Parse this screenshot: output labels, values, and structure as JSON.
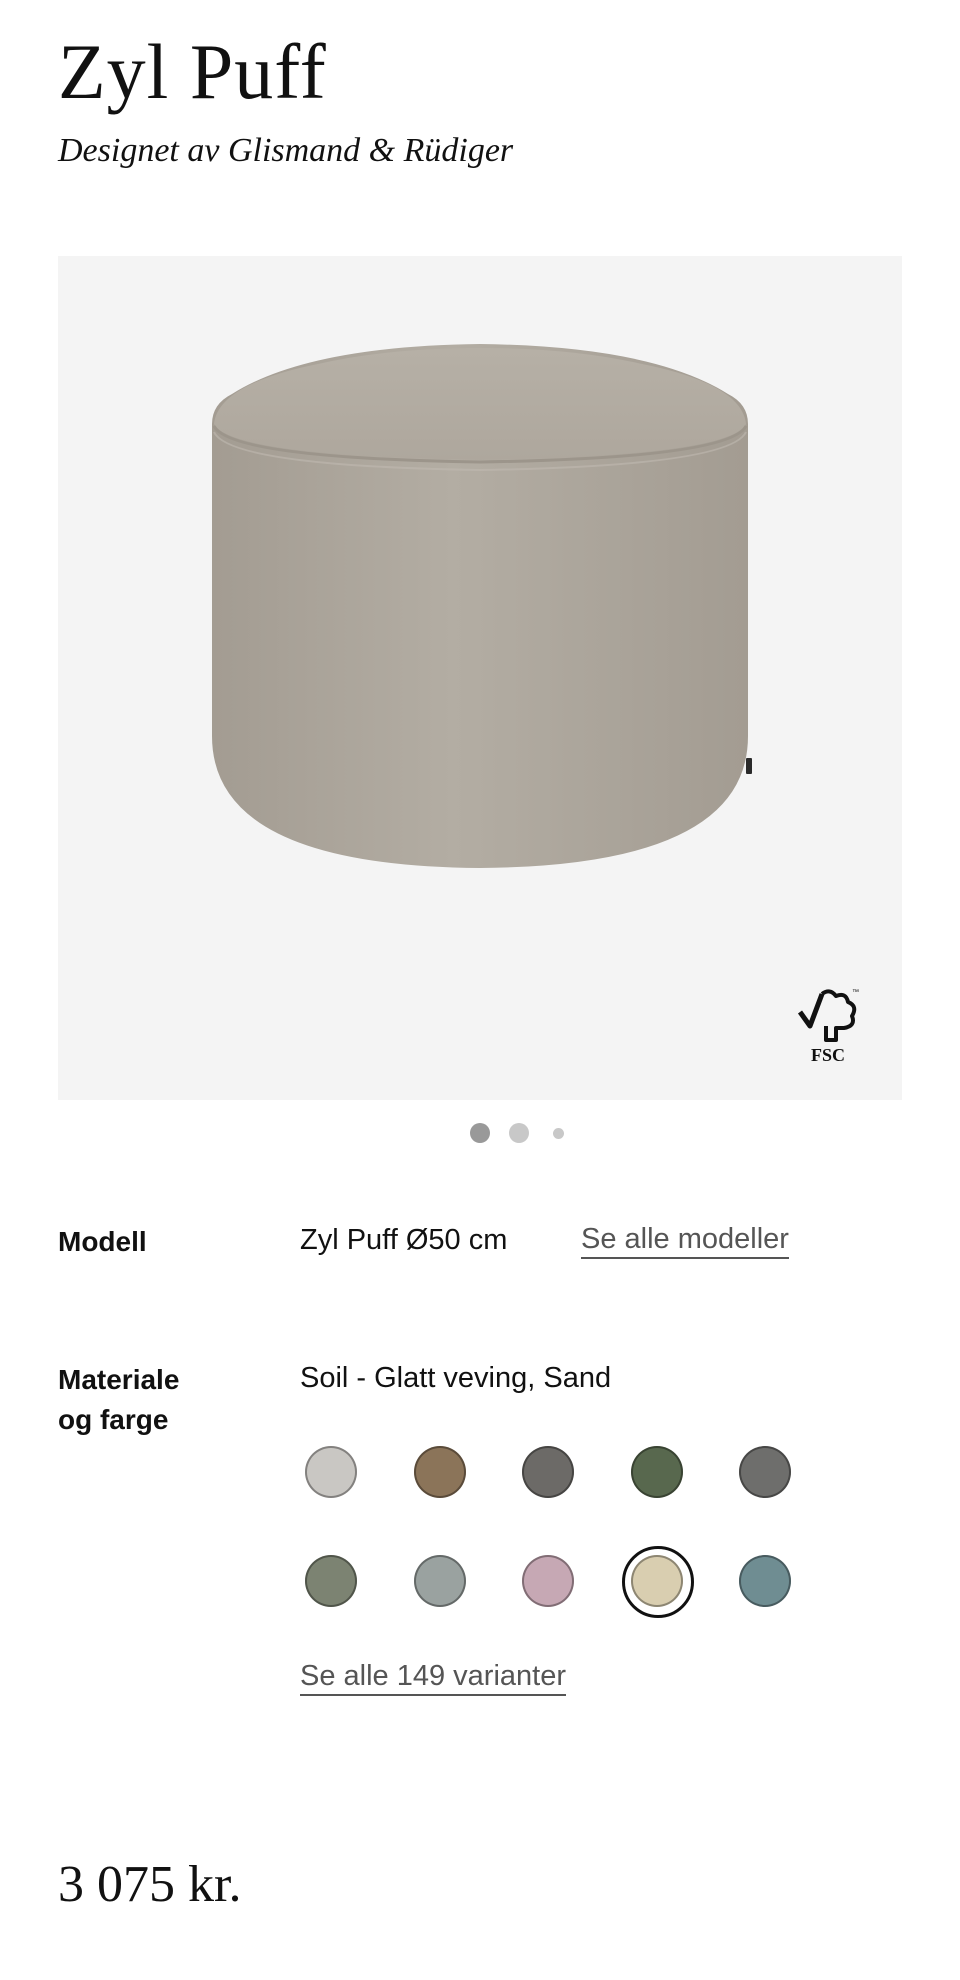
{
  "product": {
    "title": "Zyl Puff",
    "designer": "Designet av Glismand & Rüdiger",
    "price": "3 075 kr."
  },
  "gallery": {
    "image_icon": "pouf-product-photo",
    "badge_text": "FSC",
    "badge_icon": "fsc-tree-checkmark-icon",
    "slide_count": 3,
    "active_slide": 1
  },
  "model": {
    "label": "Modell",
    "value": "Zyl Puff Ø50 cm",
    "link": "Se alle modeller"
  },
  "material": {
    "label_line1": "Materiale",
    "label_line2": "og farge",
    "value": "Soil - Glatt veving, Sand",
    "swatches": [
      {
        "name": "light-grey",
        "color": "#c9c7c3",
        "selected": false
      },
      {
        "name": "brown",
        "color": "#8b7459",
        "selected": false
      },
      {
        "name": "dark-grey",
        "color": "#6c6a67",
        "selected": false
      },
      {
        "name": "dark-green",
        "color": "#58684e",
        "selected": false
      },
      {
        "name": "charcoal",
        "color": "#6e6e6c",
        "selected": false
      },
      {
        "name": "olive-grey",
        "color": "#7c8372",
        "selected": false
      },
      {
        "name": "blue-grey",
        "color": "#9aa2a0",
        "selected": false
      },
      {
        "name": "dusty-pink",
        "color": "#c6a8b4",
        "selected": false
      },
      {
        "name": "sand",
        "color": "#d9ceb0",
        "selected": true
      },
      {
        "name": "teal-grey",
        "color": "#6f8d92",
        "selected": false
      }
    ],
    "link": "Se alle 149 varianter"
  },
  "colors": {
    "gallery_bg": "#f4f4f4",
    "pouf_fabric": "#afa89e",
    "link_text": "#555555"
  }
}
